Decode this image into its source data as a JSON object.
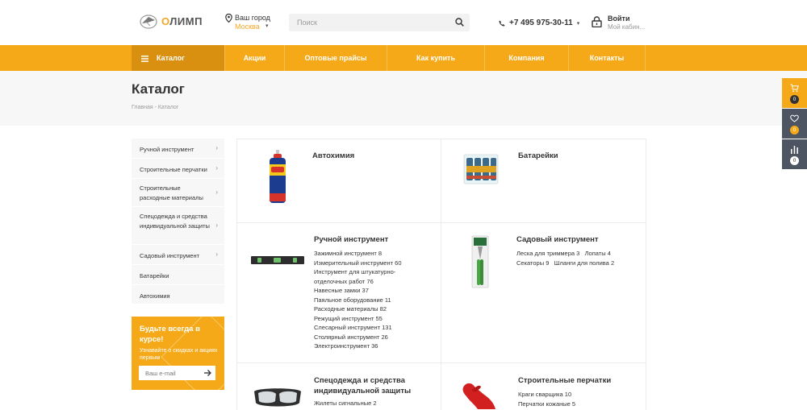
{
  "header": {
    "logo_text_accent": "О",
    "logo_text_rest": "ЛИМП",
    "city_label": "Ваш город",
    "city_value": "Москва",
    "search_placeholder": "Поиск",
    "phone": "+7 495 975-30-11",
    "login_title": "Войти",
    "login_sub": "Мой кабин..."
  },
  "nav": {
    "catalog": "Каталог",
    "items": [
      "Акции",
      "Оптовые прайсы",
      "Как купить",
      "Компания",
      "Контакты"
    ]
  },
  "page": {
    "title": "Каталог",
    "breadcrumb": [
      "Главная",
      "-",
      "Каталог"
    ]
  },
  "sidebar": {
    "items": [
      {
        "label": "Ручной инструмент",
        "has_children": true
      },
      {
        "label": "Строительные перчатки",
        "has_children": true
      },
      {
        "label": "Строительные расходные материалы",
        "has_children": true
      },
      {
        "label": "Спецодежда и средства индивидуальной защиты",
        "has_children": true
      },
      {
        "label": "Садовый инструмент",
        "has_children": true
      },
      {
        "label": "Батарейки",
        "has_children": false
      },
      {
        "label": "Автохимия",
        "has_children": false
      }
    ]
  },
  "subscribe": {
    "title": "Будьте всегда в курсе!",
    "text": "Узнавайте о скидках и акциях первым",
    "placeholder": "Ваш e-mail"
  },
  "catalog": {
    "autochem": {
      "title": "Автохимия"
    },
    "batteries": {
      "title": "Батарейки"
    },
    "hand_tools": {
      "title": "Ручной инструмент",
      "subs": [
        {
          "name": "Зажимной инструмент",
          "count": "8"
        },
        {
          "name": "Измерительный инструмент",
          "count": "60"
        },
        {
          "name": "Инструмент для штукатурно-",
          "count": ""
        },
        {
          "name": "отделочных работ",
          "count": "76"
        },
        {
          "name": "Навесные замки",
          "count": "37"
        },
        {
          "name": "Паяльное оборудование",
          "count": "11"
        },
        {
          "name": "Расходные материалы",
          "count": "82"
        },
        {
          "name": "Режущий инструмент",
          "count": "55"
        },
        {
          "name": "Слесарный инструмент",
          "count": "131"
        },
        {
          "name": "Столярный инструмент",
          "count": "26"
        },
        {
          "name": "Электроинструмент",
          "count": "36"
        }
      ]
    },
    "garden_tools": {
      "title": "Садовый инструмент",
      "row1": [
        {
          "name": "Леска для триммера",
          "count": "3"
        },
        {
          "name": "Лопаты",
          "count": "4"
        }
      ],
      "row2": [
        {
          "name": "Секаторы",
          "count": "9"
        },
        {
          "name": "Шланги для полива",
          "count": "2"
        }
      ]
    },
    "workwear": {
      "title_line1": "Спецодежда и средства",
      "title_line2": "индивидуальной защиты",
      "subs": [
        {
          "name": "Жилеты сигнальные",
          "count": "2"
        }
      ]
    },
    "gloves": {
      "title": "Строительные перчатки",
      "subs": [
        {
          "name": "Краги сварщика",
          "count": "10"
        },
        {
          "name": "Перчатки кожаные",
          "count": "5"
        }
      ]
    }
  },
  "floating": {
    "cart_count": "0",
    "favorites_count": "0",
    "compare_count": "0"
  },
  "colors": {
    "accent": "#f5a918",
    "accent_dark": "#d98f0f",
    "panel_dark": "#4d5563"
  }
}
